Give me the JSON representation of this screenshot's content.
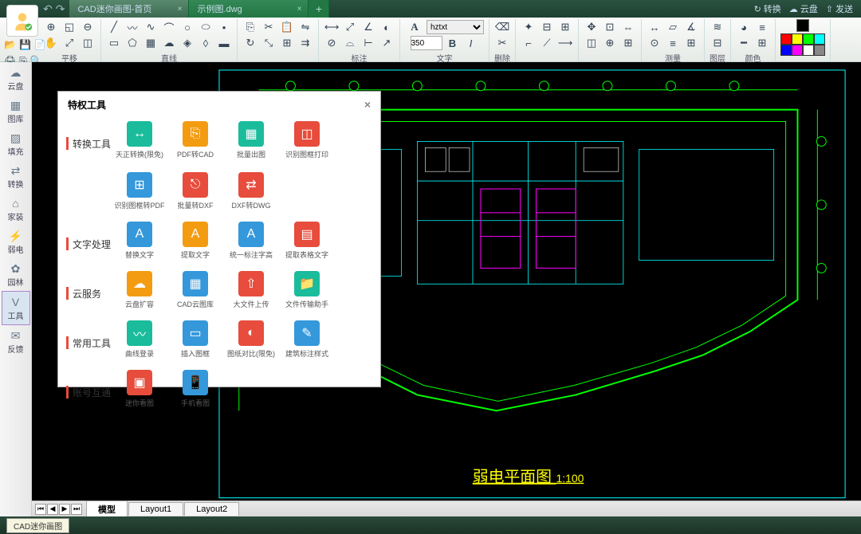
{
  "titlebar": {
    "tab1": "CAD迷你画图-首页",
    "tab2": "示例图.dwg",
    "convert": "转换",
    "cloud": "云盘",
    "send": "发送"
  },
  "toolbar_labels": {
    "pan": "平移",
    "line": "直线",
    "dim": "标注",
    "text": "文字",
    "del": "删除",
    "measure": "测量",
    "layer": "图层",
    "color": "颜色"
  },
  "font": {
    "name": "hztxt",
    "size": "350",
    "bold": "B",
    "italic": "I"
  },
  "sidebar": {
    "items": [
      {
        "label": "云盘"
      },
      {
        "label": "图库"
      },
      {
        "label": "填充"
      },
      {
        "label": "转换"
      },
      {
        "label": "家装"
      },
      {
        "label": "弱电"
      },
      {
        "label": "园林"
      },
      {
        "label": "工具"
      },
      {
        "label": "反馈"
      }
    ]
  },
  "modal": {
    "title": "特权工具",
    "sections": [
      {
        "title": "转换工具",
        "items": [
          {
            "label": "天正转换(限免)",
            "color": "#1abc9c"
          },
          {
            "label": "PDF转CAD",
            "color": "#f39c12"
          },
          {
            "label": "批量出图",
            "color": "#1abc9c"
          },
          {
            "label": "识别图框打印",
            "color": "#e74c3c"
          },
          {
            "label": "识别图框转PDF",
            "color": "#3498db"
          },
          {
            "label": "批量转DXF",
            "color": "#e74c3c"
          },
          {
            "label": "DXF转DWG",
            "color": "#e74c3c"
          }
        ]
      },
      {
        "title": "文字处理",
        "items": [
          {
            "label": "替换文字",
            "color": "#3498db"
          },
          {
            "label": "提取文字",
            "color": "#f39c12"
          },
          {
            "label": "统一标注字高",
            "color": "#3498db"
          },
          {
            "label": "提取表格文字",
            "color": "#e74c3c"
          }
        ]
      },
      {
        "title": "云服务",
        "items": [
          {
            "label": "云盘扩容",
            "color": "#f39c12"
          },
          {
            "label": "CAD云图库",
            "color": "#3498db"
          },
          {
            "label": "大文件上传",
            "color": "#e74c3c"
          },
          {
            "label": "文件传输助手",
            "color": "#1abc9c"
          }
        ]
      },
      {
        "title": "常用工具",
        "items": [
          {
            "label": "曲线登录",
            "color": "#1abc9c"
          },
          {
            "label": "插入图框",
            "color": "#3498db"
          },
          {
            "label": "图纸对比(限免)",
            "color": "#e74c3c"
          },
          {
            "label": "建筑标注样式",
            "color": "#3498db"
          }
        ]
      },
      {
        "title": "账号互通",
        "items": [
          {
            "label": "迷你看图",
            "color": "#e74c3c"
          },
          {
            "label": "手机看图",
            "color": "#3498db"
          }
        ]
      }
    ]
  },
  "drawing": {
    "title": "弱电平面图",
    "scale": "1:100"
  },
  "bottom_tabs": {
    "model": "模型",
    "l1": "Layout1",
    "l2": "Layout2"
  },
  "colors": [
    "#ff0000",
    "#ffff00",
    "#00ff00",
    "#00ffff",
    "#0000ff",
    "#ff00ff",
    "#ffffff",
    "#888888"
  ]
}
